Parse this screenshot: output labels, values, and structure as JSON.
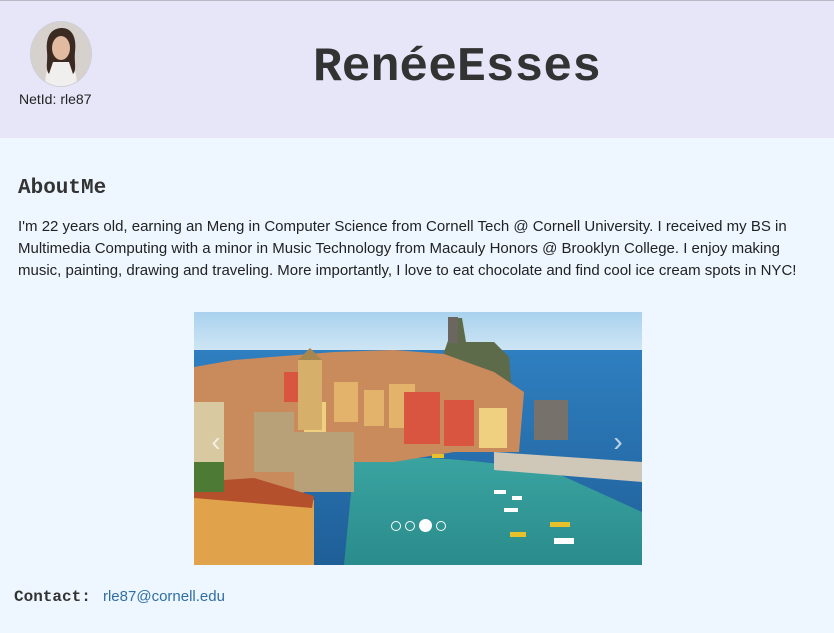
{
  "header": {
    "title": "RenéeEsses",
    "netid_label": "NetId:",
    "netid_value": "rle87"
  },
  "about": {
    "heading": "AboutMe",
    "text": "I'm 22 years old, earning an Meng in Computer Science from Cornell Tech @ Cornell University. I received my BS in Multimedia Computing with a minor in Music Technology from Macauly Honors @ Brooklyn College. I enjoy making music, painting, drawing and traveling. More importantly, I love to eat chocolate and find cool ice cream spots in NYC!"
  },
  "carousel": {
    "slide_count": 4,
    "active_slide": 3,
    "prev_icon": "chevron-left-icon",
    "next_icon": "chevron-right-icon"
  },
  "contact": {
    "label": "Contact:",
    "email": "rle87@cornell.edu"
  },
  "colors": {
    "page_bg": "#eef7ff",
    "header_bg": "#e6e6f8",
    "link": "#2f6ea5"
  }
}
